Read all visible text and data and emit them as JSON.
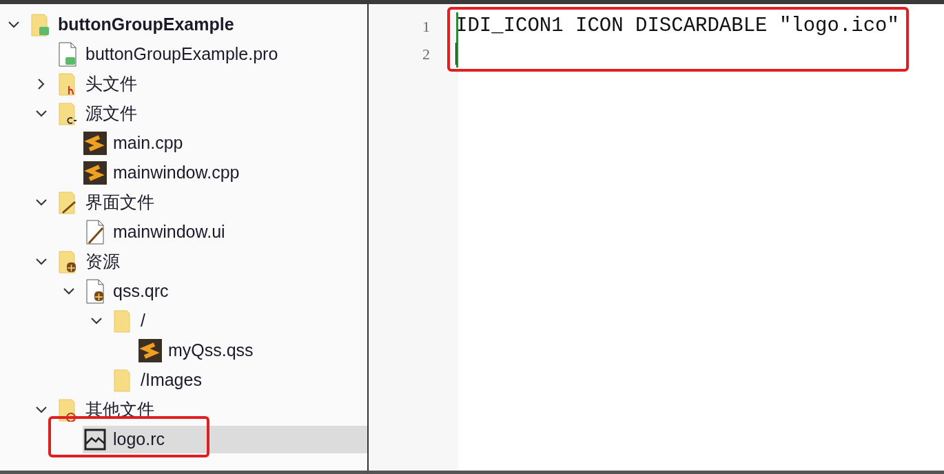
{
  "project_tree": [
    {
      "label": "buttonGroupExample",
      "kind": "project",
      "expanded": true,
      "selected": false,
      "children": [
        {
          "label": "buttonGroupExample.pro",
          "kind": "pro",
          "selected": false
        },
        {
          "label": "头文件",
          "kind": "header-folder",
          "expanded": false,
          "selected": false
        },
        {
          "label": "源文件",
          "kind": "source-folder",
          "expanded": true,
          "selected": false,
          "children": [
            {
              "label": "main.cpp",
              "kind": "cpp",
              "selected": false
            },
            {
              "label": "mainwindow.cpp",
              "kind": "cpp",
              "selected": false
            }
          ]
        },
        {
          "label": "界面文件",
          "kind": "form-folder",
          "expanded": true,
          "selected": false,
          "children": [
            {
              "label": "mainwindow.ui",
              "kind": "ui",
              "selected": false
            }
          ]
        },
        {
          "label": "资源",
          "kind": "resource-folder",
          "expanded": true,
          "selected": false,
          "children": [
            {
              "label": "qss.qrc",
              "kind": "qrc",
              "expanded": true,
              "selected": false,
              "children": [
                {
                  "label": "/",
                  "kind": "folder",
                  "expanded": true,
                  "selected": false,
                  "children": [
                    {
                      "label": "myQss.qss",
                      "kind": "cpp",
                      "selected": false
                    }
                  ]
                },
                {
                  "label": "/Images",
                  "kind": "folder",
                  "selected": false
                }
              ]
            }
          ]
        },
        {
          "label": "其他文件",
          "kind": "other-folder",
          "expanded": true,
          "selected": false,
          "children": [
            {
              "label": "logo.rc",
              "kind": "image",
              "selected": true
            }
          ]
        }
      ]
    }
  ],
  "editor": {
    "lines": [
      {
        "number": "1",
        "text": "IDI_ICON1 ICON DISCARDABLE \"logo.ico\"",
        "cursor": false
      },
      {
        "number": "2",
        "cursor": true
      }
    ]
  }
}
